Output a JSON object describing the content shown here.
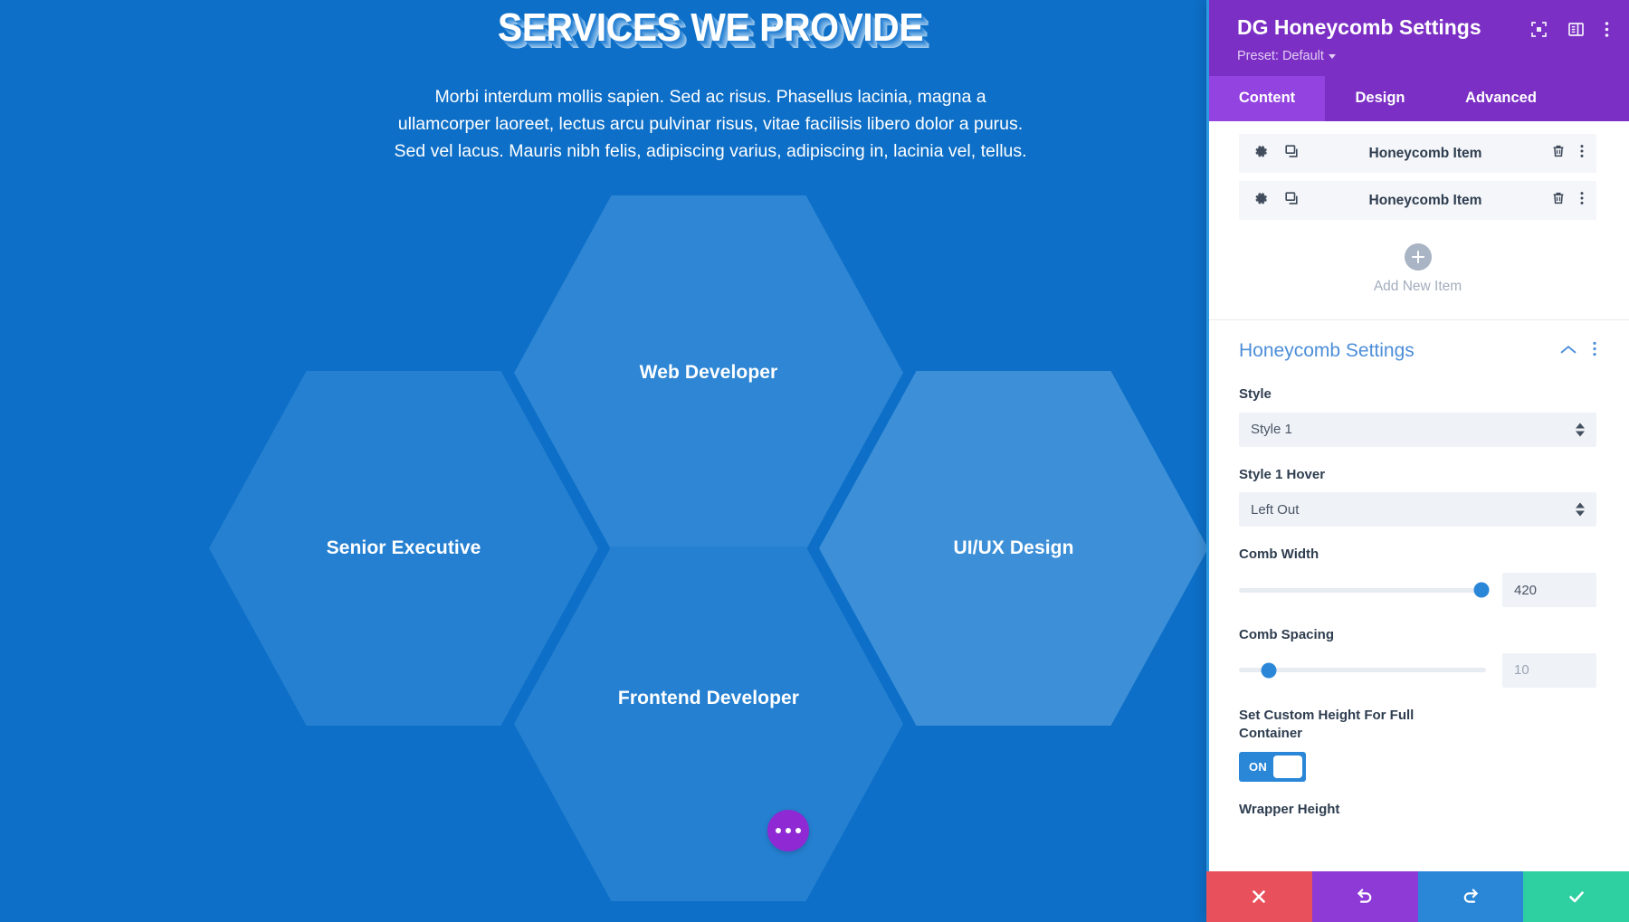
{
  "page": {
    "hero": {
      "title": "SERVICES WE PROVIDE",
      "body": "Morbi interdum mollis sapien. Sed ac risus. Phasellus lacinia, magna a ullamcorper laoreet, lectus arcu pulvinar risus, vitae facilisis libero dolor a purus. Sed vel lacus. Mauris nibh felis, adipiscing varius, adipiscing in, lacinia vel, tellus."
    },
    "combs": [
      {
        "label": "Web Developer"
      },
      {
        "label": "Senior Executive"
      },
      {
        "label": "UI/UX Design"
      },
      {
        "label": "Frontend Developer"
      }
    ],
    "fab": {
      "icon": "more-dots-icon"
    },
    "colors": {
      "background": "#0d6fc7",
      "comb_light": "#2e86d4",
      "comb_lighter": "#3d90d8",
      "fab": "#8e29d4"
    }
  },
  "panel": {
    "title": "DG Honeycomb Settings",
    "preset_label": "Preset: Default",
    "header_icons": [
      {
        "name": "focus-icon"
      },
      {
        "name": "layout-panel-icon"
      },
      {
        "name": "kebab-menu-icon"
      }
    ],
    "tabs": [
      {
        "label": "Content",
        "active": true
      },
      {
        "label": "Design",
        "active": false
      },
      {
        "label": "Advanced",
        "active": false
      }
    ],
    "items": [
      {
        "label": "Honeycomb Item"
      },
      {
        "label": "Honeycomb Item"
      }
    ],
    "add_new": {
      "label": "Add New Item"
    },
    "settings": {
      "title": "Honeycomb Settings",
      "style": {
        "label": "Style",
        "value": "Style 1"
      },
      "style_hover": {
        "label": "Style 1 Hover",
        "value": "Left Out"
      },
      "comb_width": {
        "label": "Comb Width",
        "value": "420",
        "percent": 98
      },
      "comb_spacing": {
        "label": "Comb Spacing",
        "value": "10",
        "percent": 12
      },
      "custom_height": {
        "label": "Set Custom Height For Full Container",
        "toggle": "ON"
      },
      "wrapper_height": {
        "label": "Wrapper Height"
      }
    },
    "actions": [
      {
        "name": "cancel",
        "icon": "close-icon"
      },
      {
        "name": "undo",
        "icon": "undo-icon"
      },
      {
        "name": "redo",
        "icon": "redo-icon"
      },
      {
        "name": "save",
        "icon": "check-icon"
      }
    ],
    "colors": {
      "header": "#7b2fc4",
      "tab_active": "#9343e0",
      "accent_blue": "#2a87d8",
      "section_title": "#4c8ed9"
    }
  }
}
